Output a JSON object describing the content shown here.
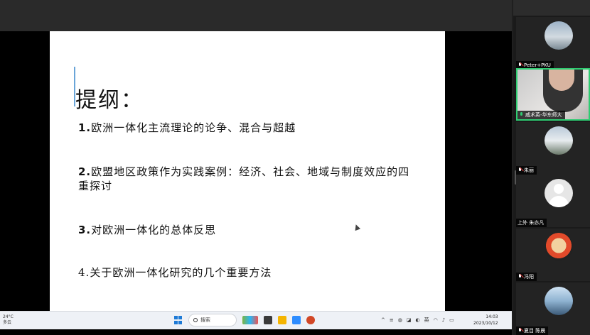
{
  "slide": {
    "title": "提纲：",
    "items": [
      {
        "num": "1.",
        "text": "欧洲一体化主流理论的论争、混合与超越"
      },
      {
        "num": "2.",
        "text": "欧盟地区政策作为实践案例：经济、社会、地域与制度效应的四重探讨"
      },
      {
        "num": "3.",
        "text": "对欧洲一体化的总体反思"
      },
      {
        "num": "4.",
        "text": "关于欧洲一体化研究的几个重要方法"
      }
    ]
  },
  "taskbar": {
    "weather_temp": "24°C",
    "weather_desc": "多云",
    "search_label": "搜索",
    "tray_lang": "英",
    "clock_time": "14:03",
    "clock_date": "2023/10/12"
  },
  "participants": [
    {
      "name": "Peter+PKU",
      "mic": "muted",
      "avatar": "landscape"
    },
    {
      "name": "戚术英-华东师大",
      "mic": "on",
      "avatar": "video"
    },
    {
      "name": "朱丽",
      "mic": "muted",
      "avatar": "landscape"
    },
    {
      "name": "上外 朱亦凡",
      "mic": "none",
      "avatar": "default"
    },
    {
      "name": "冯阳",
      "mic": "muted",
      "avatar": "cartoon"
    },
    {
      "name": "夏目 陈晨",
      "mic": "muted",
      "avatar": "city"
    }
  ],
  "colors": {
    "active_speaker": "#2ecc71",
    "muted": "#e03a3a",
    "slide_bg": "#ffffff"
  }
}
